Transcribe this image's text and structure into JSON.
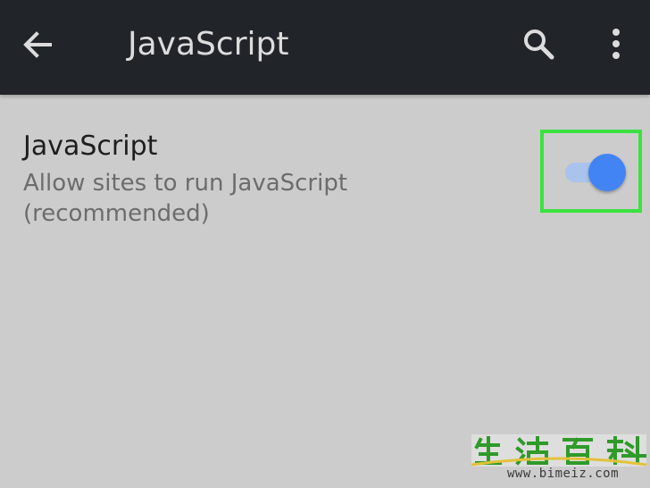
{
  "app_bar": {
    "title": "JavaScript",
    "back_icon": "arrow-left-icon",
    "search_icon": "search-icon",
    "more_icon": "more-vertical-icon",
    "background_color": "#212529"
  },
  "setting": {
    "title": "JavaScript",
    "summary": "Allow sites to run JavaScript (recommended)",
    "toggle": {
      "state": "on",
      "track_color": "#a9c3ec",
      "thumb_color": "#4284f3"
    },
    "highlight_color": "#3ae23f"
  },
  "watermark": {
    "logo_text": "生活百科",
    "url": "www.bimeiz.com"
  }
}
